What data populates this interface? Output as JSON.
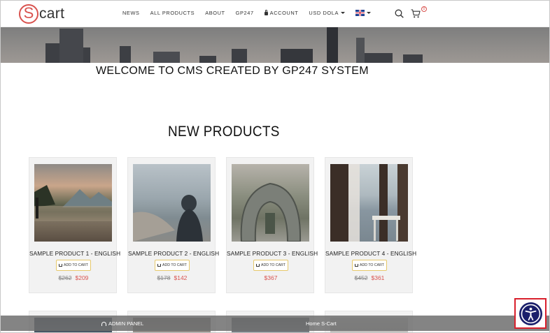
{
  "header": {
    "logo_letter": "S",
    "logo_rest": "cart",
    "nav": {
      "news": "NEWS",
      "all_products": "ALL PRODUCTS",
      "about": "ABOUT",
      "gp247": "GP247",
      "account": "ACCOUNT",
      "currency": "USD DOLA"
    },
    "cart_count": "0"
  },
  "welcome": "WELCOME TO CMS CREATED BY GP247 SYSTEM",
  "section_title": "NEW PRODUCTS",
  "add_to_cart_label": "ADD TO CART",
  "products": [
    {
      "name": "SAMPLE PRODUCT 1 - ENGLISH",
      "old_price": "$262",
      "price": "$209"
    },
    {
      "name": "SAMPLE PRODUCT 2 - ENGLISH",
      "old_price": "$178",
      "price": "$142"
    },
    {
      "name": "SAMPLE PRODUCT 3 - ENGLISH",
      "old_price": "",
      "price": "$367"
    },
    {
      "name": "SAMPLE PRODUCT 4 - ENGLISH",
      "old_price": "$452",
      "price": "$361"
    }
  ],
  "admin_bar": {
    "admin_panel": "ADMIN PANEL",
    "home": "Home S-Cart"
  },
  "colors": {
    "accent": "#d9534f",
    "button_border": "#e6c86a",
    "accessibility": "#1a1f6b",
    "highlight": "#d9202c"
  }
}
